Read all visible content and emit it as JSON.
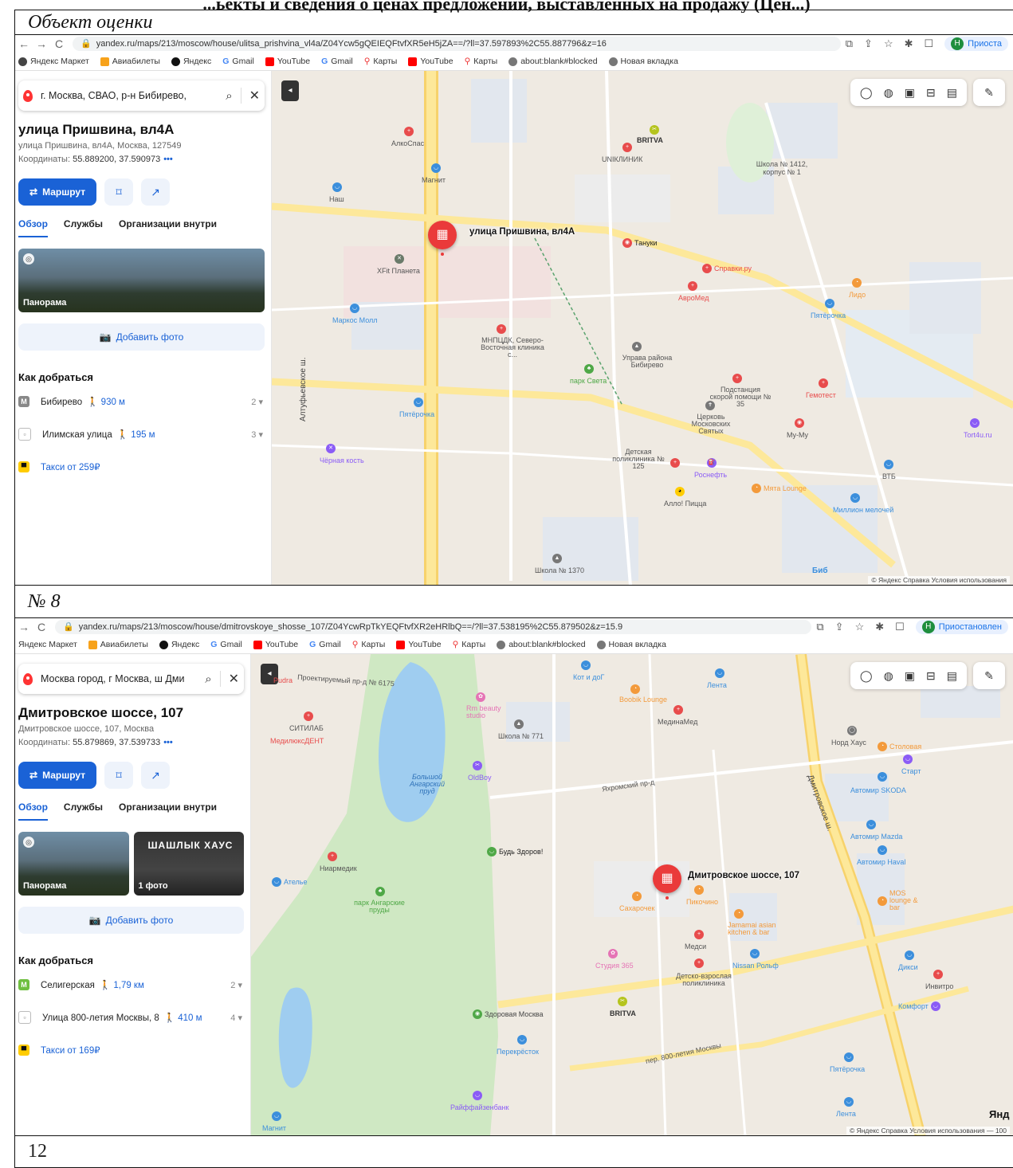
{
  "document": {
    "header_fragment": "...ьекты и сведения о ценах предложений, выставленных на продажу (Цен...)",
    "caption_1": "Объект оценки",
    "caption_2": "№ 8",
    "page_number": "12"
  },
  "shot1": {
    "url": "yandex.ru/maps/213/moscow/house/ulitsa_prishvina_vl4a/Z04Ycw5gQEIEQFtvfXR5eH5jZA==/?ll=37.597893%2C55.887796&z=16",
    "profile_status": "Приоста",
    "bookmarks": [
      "Яндекс Маркет",
      "Авиабилеты",
      "Яндекс",
      "Gmail",
      "YouTube",
      "Gmail",
      "Карты",
      "YouTube",
      "Карты",
      "about:blank#blocked",
      "Новая вкладка"
    ],
    "search_query": "г. Москва, СВАО, р-н Бибирево,",
    "title": "улица Пришвина, вл4А",
    "address": "улица Пришвина, вл4А, Москва, 127549",
    "coords_label": "Координаты:",
    "coords_value": "55.889200, 37.590973",
    "more": "•••",
    "route_label": "Маршрут",
    "tabs": [
      "Обзор",
      "Службы",
      "Организации внутри"
    ],
    "photo_label": "Панорама",
    "add_photo": "Добавить фото",
    "howto_title": "Как добраться",
    "transport": [
      {
        "name": "Бибирево",
        "dist": "930 м",
        "count": "2",
        "icon": "metro-icon"
      },
      {
        "name": "Илимская улица",
        "dist": "195 м",
        "count": "3",
        "icon": "bus-stop-icon"
      }
    ],
    "taxi": "Такси от 259₽",
    "pin_label": "улица Пришвина, вл4А",
    "copyright": "© Яндекс  Справка  Условия использования",
    "map_labels": {
      "l1": "АлкоСпас",
      "l2": "BRITVA",
      "l3": "UNIКЛИНИК",
      "l4": "Школа № 1412, корпус № 1",
      "l5": "Магнит",
      "l6": "Наш",
      "l7": "Тануки",
      "l8": "XFit Планета",
      "l9": "Справки.ру",
      "l10": "АвроМед",
      "l11": "Лидо",
      "l12": "Пятёрочка",
      "l13": "Маркос Молл",
      "l14": "МНПЦДК, Северо-Восточная клиника с...",
      "l15": "Управа района Бибирево",
      "l16": "парк Света",
      "l17": "Подстанция скорой помощи № 35",
      "l18": "Гемотест",
      "l19": "Пятёрочка",
      "l20": "Церковь Московских Святых",
      "l21": "My-My",
      "l22": "Tort4u.ru",
      "l23": "Алтуфьевское ш.",
      "l24": "Чёрная кость",
      "l25": "Детская поликлиника № 125",
      "l26": "Роснефть",
      "l27": "Мята Lounge",
      "l28": "ВТБ",
      "l29": "Алло! Пицца",
      "l30": "Миллион мелочей",
      "l31": "Школа № 1370",
      "l32": "Биб"
    }
  },
  "shot2": {
    "url": "yandex.ru/maps/213/moscow/house/dmitrovskoye_shosse_107/Z04YcwRpTkYEQFtvfXR2eHRlbQ==/?ll=37.538195%2C55.879502&z=15.9",
    "profile_status": "Приостановлен",
    "bookmarks": [
      "Яндекс Маркет",
      "Авиабилеты",
      "Яндекс",
      "Gmail",
      "YouTube",
      "Gmail",
      "Карты",
      "YouTube",
      "Карты",
      "about:blank#blocked",
      "Новая вкладка"
    ],
    "search_query": "Москва город, г Москва, ш Дми",
    "title": "Дмитровское шоссе, 107",
    "address": "Дмитровское шоссе, 107, Москва",
    "coords_label": "Координаты:",
    "coords_value": "55.879869, 37.539733",
    "more": "•••",
    "route_label": "Маршрут",
    "tabs": [
      "Обзор",
      "Службы",
      "Организации внутри"
    ],
    "photo_label": "Панорама",
    "photo2_label": "1 фото",
    "photo2_sign": "ШАШЛЫК ХАУС",
    "add_photo": "Добавить фото",
    "howto_title": "Как добраться",
    "transport": [
      {
        "name": "Селигерская",
        "dist": "1,79 км",
        "count": "2",
        "icon": "metro-icon"
      },
      {
        "name": "Улица 800-летия Москвы, 8",
        "dist": "410 м",
        "count": "4",
        "icon": "bus-stop-icon"
      }
    ],
    "taxi": "Такси от 169₽",
    "pin_label": "Дмитровское шоссе, 107",
    "copyright": "© Яндекс  Справка  Условия использования",
    "map_labels": {
      "m1": "Pudra",
      "m2": "Проектируемый пр-д № 6175",
      "m3": "Кот и доГ",
      "m4": "Лента",
      "m5": "Boobik Lounge",
      "m6": "Rm beauty studio",
      "m7": "СИТИЛАБ",
      "m8": "МедилюксДЕНТ",
      "m9": "Школа № 771",
      "m10": "МединаМед",
      "m11": "Норд Хаус",
      "m12": "Столовая",
      "m13": "Старт",
      "m14": "Большой Ангарский пруд",
      "m15": "OldBoy",
      "m16": "Яхромский пр-д",
      "m17": "Автомир SKODA",
      "m18": "Дмитровское ш.",
      "m19": "Будь Здоров!",
      "m20": "Автомир Mazda",
      "m21": "Автомир Haval",
      "m22": "Ниармедик",
      "m23": "Ателье",
      "m24": "парк Ангарские пруды",
      "m25": "Сахарочек",
      "m26": "Пикочино",
      "m27": "MOS lounge & bar",
      "m28": "Jamamai asian kitchen & bar",
      "m29": "Медси",
      "m30": "Студия 365",
      "m31": "Nissan Рольф",
      "m32": "Детско-взрослая поликлиника",
      "m33": "Дикси",
      "m34": "Инвитро",
      "m35": "BRITVA",
      "m36": "Здоровая Москва",
      "m37": "Комфорт",
      "m38": "Перекрёсток",
      "m39": "пер. 800-летия Москвы",
      "m40": "Пятёрочка",
      "m41": "Райффайзенбанк",
      "m42": "Лента",
      "m43": "Магнит",
      "m44": "Янд",
      "m45": "100"
    }
  }
}
